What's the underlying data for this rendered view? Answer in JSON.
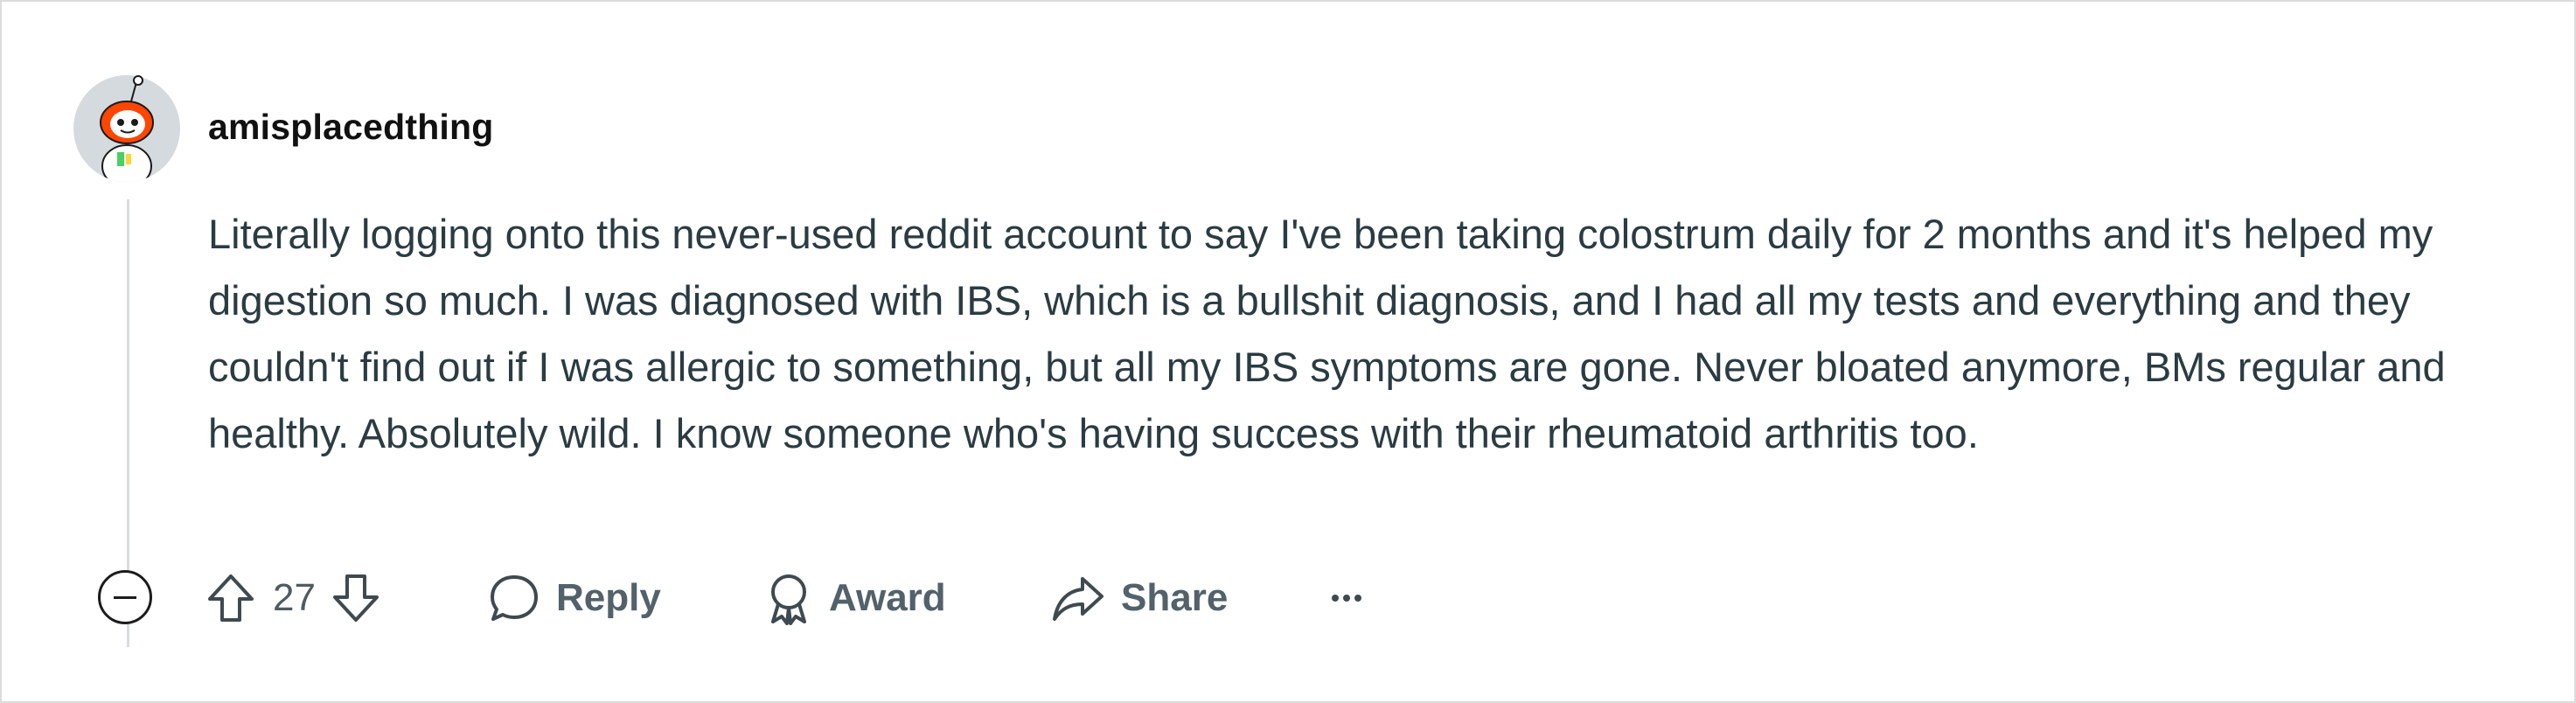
{
  "comment": {
    "author": "amisplacedthing",
    "body": "Literally logging onto this never-used reddit account to say I've been taking colostrum daily for 2 months and it's helped my digestion so much. I was diagnosed with IBS, which is a bullshit diagnosis, and I had all my tests and everything and they couldn't find out if I was allergic to something, but all my IBS symptoms are gone. Never bloated anymore, BMs regular and healthy. Absolutely wild. I know someone who's having success with their rheumatoid arthritis too.",
    "score": "27"
  },
  "actions": {
    "reply_label": "Reply",
    "award_label": "Award",
    "share_label": "Share"
  },
  "icons": {
    "avatar": "reddit-snoo-avatar",
    "collapse": "collapse-minus-icon",
    "upvote": "upvote-arrow-icon",
    "downvote": "downvote-arrow-icon",
    "reply": "speech-bubble-icon",
    "award": "award-ribbon-icon",
    "share": "share-arrow-icon",
    "more": "more-dots-icon"
  },
  "colors": {
    "avatar_accent": "#ff4500",
    "text": "#2a3c42",
    "muted": "#4f5b61"
  }
}
